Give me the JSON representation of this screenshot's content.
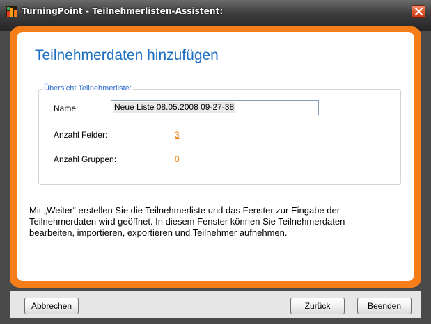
{
  "window": {
    "title": "TurningPoint - Teilnehmerlisten-Assistent:",
    "icons": {
      "app": "turningpoint-app-icon",
      "close": "close-icon"
    },
    "colors": {
      "accent_frame": "#f57e18",
      "heading": "#1b6ec2",
      "link": "#f08010",
      "close": "#e35a32"
    }
  },
  "main": {
    "heading": "Teilnehmerdaten hinzufügen",
    "groupbox": {
      "legend": "Übersicht Teilnehmerliste:",
      "name_label": "Name:",
      "name_value": "Neue Liste 08.05.2008 09-27-38",
      "fields_label": "Anzahl Felder:",
      "fields_value": "3",
      "groups_label": "Anzahl Gruppen:",
      "groups_value": "0"
    },
    "info_text": "Mit „Weiter“ erstellen Sie die Teilnehmerliste und das Fenster zur Eingabe der Teilnehmerdaten wird geöffnet. In diesem Fenster können Sie Teilnehmerdaten bearbeiten, importieren, exportieren und Teilnehmer aufnehmen."
  },
  "footer": {
    "cancel_label": "Abbrechen",
    "back_label": "Zurück",
    "finish_label": "Beenden"
  }
}
